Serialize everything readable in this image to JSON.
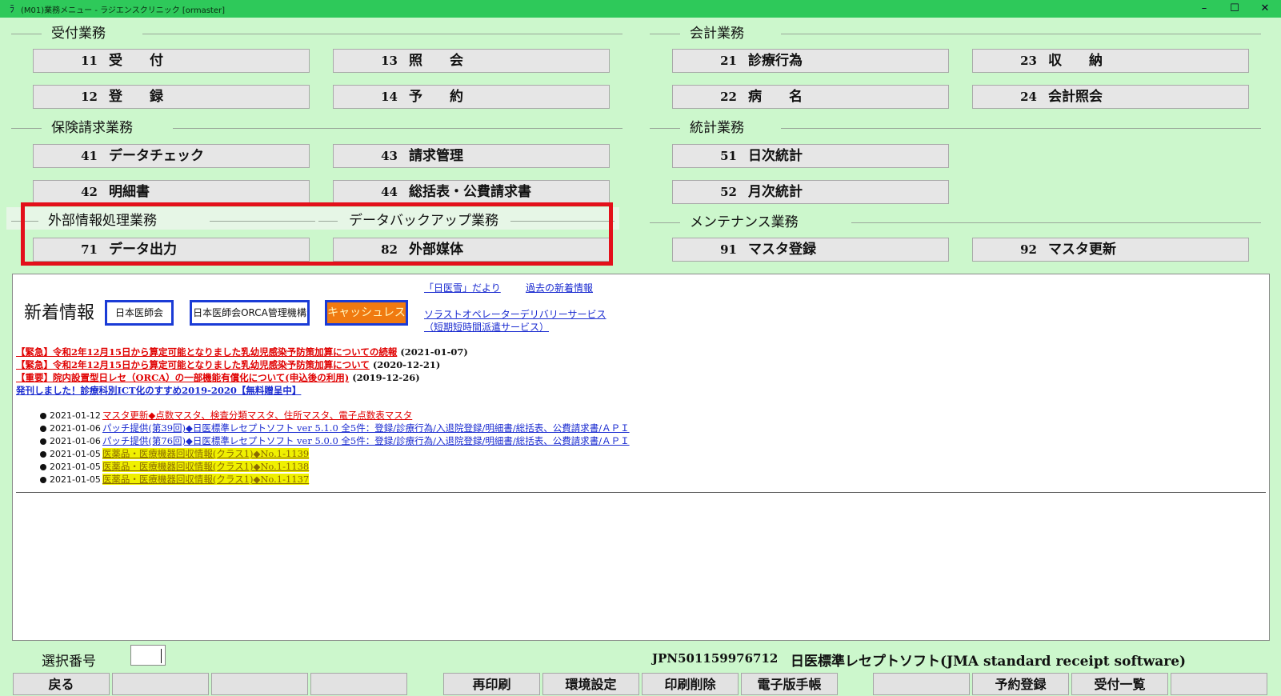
{
  "window": {
    "title": "(M01)業務メニュー - ラジエンスクリニック [ormaster]",
    "minimize": "–",
    "maximize": "☐",
    "close": "✕"
  },
  "sections": {
    "uketsuke": "受付業務",
    "kaikei": "会計業務",
    "hoken": "保険請求業務",
    "toukei": "統計業務",
    "gaibu": "外部情報処理業務",
    "backup": "データバックアップ業務",
    "maintenance": "メンテナンス業務"
  },
  "buttons": {
    "b11": {
      "num": "11",
      "label": "受　　付"
    },
    "b13": {
      "num": "13",
      "label": "照　　会"
    },
    "b21": {
      "num": "21",
      "label": "診療行為"
    },
    "b23": {
      "num": "23",
      "label": "収　　納"
    },
    "b12": {
      "num": "12",
      "label": "登　　録"
    },
    "b14": {
      "num": "14",
      "label": "予　　約"
    },
    "b22": {
      "num": "22",
      "label": "病　　名"
    },
    "b24": {
      "num": "24",
      "label": "会計照会"
    },
    "b41": {
      "num": "41",
      "label": "データチェック"
    },
    "b43": {
      "num": "43",
      "label": "請求管理"
    },
    "b51": {
      "num": "51",
      "label": "日次統計"
    },
    "b42": {
      "num": "42",
      "label": "明細書"
    },
    "b44": {
      "num": "44",
      "label": "総括表・公費請求書"
    },
    "b52": {
      "num": "52",
      "label": "月次統計"
    },
    "b71": {
      "num": "71",
      "label": "データ出力"
    },
    "b82": {
      "num": "82",
      "label": "外部媒体"
    },
    "b91": {
      "num": "91",
      "label": "マスタ登録"
    },
    "b92": {
      "num": "92",
      "label": "マスタ更新"
    }
  },
  "news": {
    "title": "新着情報",
    "pill_jma": "日本医師会",
    "pill_orca": "日本医師会ORCA管理機構",
    "pill_cashless": "キャッシュレス",
    "link_nichii": "「日医雪」だより",
    "link_past": "過去の新着情報",
    "link_solast1": "ソラストオペレーターデリバリーサービス",
    "link_solast2": "（短期短時間派遣サービス）",
    "lines": [
      {
        "text": "【緊急】令和2年12月15日から算定可能となりました乳幼児感染予防策加算についての続報",
        "date": "(2021-01-07)"
      },
      {
        "text": "【緊急】令和2年12月15日から算定可能となりました乳幼児感染予防策加算について",
        "date": "(2020-12-21)"
      },
      {
        "text": "【重要】院内設置型日レセ（ORCA）の一部機能有償化について(申込後の利用)",
        "date": "(2019-12-26)"
      },
      {
        "text": "発刊しました！診療科別ICT化のすすめ2019-2020【無料贈呈中】",
        "date": ""
      }
    ],
    "items": [
      {
        "date": "2021-01-12",
        "text": "マスタ更新◆点数マスタ、検査分類マスタ、住所マスタ、電子点数表マスタ"
      },
      {
        "date": "2021-01-06",
        "text": "パッチ提供(第39回)◆日医標準レセプトソフト ver 5.1.0 全5件：登録/診療行為/入退院登録/明細書/総括表、公費請求書/ＡＰＩ"
      },
      {
        "date": "2021-01-06",
        "text": "パッチ提供(第76回)◆日医標準レセプトソフト ver 5.0.0 全5件：登録/診療行為/入退院登録/明細書/総括表、公費請求書/ＡＰＩ"
      },
      {
        "date": "2021-01-05",
        "text": "医薬品・医療機器回収情報(クラス1)◆No.1-1139"
      },
      {
        "date": "2021-01-05",
        "text": "医薬品・医療機器回収情報(クラス1)◆No.1-1138"
      },
      {
        "date": "2021-01-05",
        "text": "医薬品・医療機器回収情報(クラス1)◆No.1-1137"
      }
    ]
  },
  "footer": {
    "select_label": "選択番号",
    "select_value": "",
    "jpn": "JPN501159976712",
    "product": "日医標準レセプトソフト(JMA standard receipt software)",
    "buttons": {
      "back": "戻る",
      "reprint": "再印刷",
      "env": "環境設定",
      "printdel": "印刷削除",
      "notebook": "電子版手帳",
      "reserve": "予約登録",
      "reception": "受付一覧"
    }
  }
}
